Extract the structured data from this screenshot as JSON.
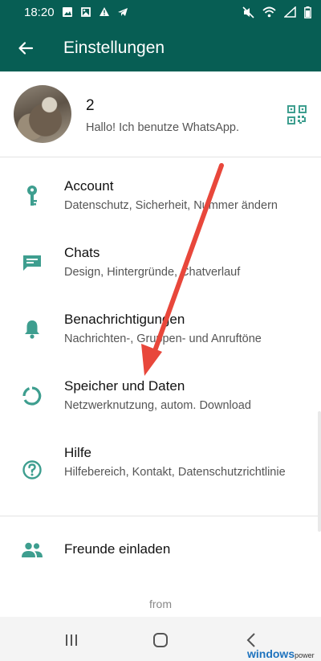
{
  "status_bar": {
    "time": "18:20",
    "left_icons": [
      "image-icon",
      "gallery-icon",
      "alert-icon",
      "telegram-icon"
    ],
    "right_icons": [
      "mute-icon",
      "wifi-icon",
      "signal-icon",
      "battery-icon"
    ]
  },
  "appbar": {
    "title": "Einstellungen"
  },
  "profile": {
    "name": "2",
    "status": "Hallo! Ich benutze WhatsApp."
  },
  "menu": [
    {
      "title": "Account",
      "subtitle": "Datenschutz, Sicherheit, Nummer ändern",
      "icon": "key-icon"
    },
    {
      "title": "Chats",
      "subtitle": "Design, Hintergründe, Chatverlauf",
      "icon": "chat-icon"
    },
    {
      "title": "Benachrichtigungen",
      "subtitle": "Nachrichten-, Gruppen- und Anruftöne",
      "icon": "bell-icon"
    },
    {
      "title": "Speicher und Daten",
      "subtitle": "Netzwerknutzung, autom. Download",
      "icon": "data-usage-icon"
    },
    {
      "title": "Hilfe",
      "subtitle": "Hilfebereich, Kontakt, Datenschutzrichtlinie",
      "icon": "help-icon"
    },
    {
      "title": "Freunde einladen",
      "icon": "people-icon"
    }
  ],
  "footer": {
    "from": "from"
  },
  "watermark": {
    "brand": "windows",
    "suffix": "power"
  },
  "colors": {
    "primary": "#075e54",
    "icon": "#3e9e8f",
    "arrow": "#e8473b"
  }
}
